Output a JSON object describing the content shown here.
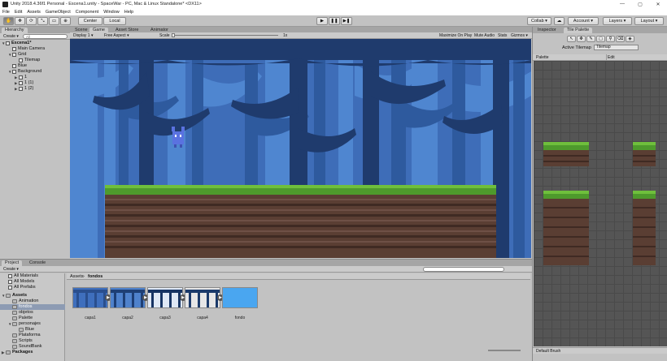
{
  "window": {
    "title": "Unity 2018.4.36f1 Personal - Escena1.unity - SpaceWar - PC, Mac & Linux Standalone* <DX11>",
    "minimize": "—",
    "maximize": "▢",
    "close": "✕"
  },
  "menu": [
    "File",
    "Edit",
    "Assets",
    "GameObject",
    "Component",
    "Window",
    "Help"
  ],
  "toolbar": {
    "pivot": "Center",
    "space": "Local",
    "play": "▶",
    "pause": "❚❚",
    "step": "▶❚",
    "collab": "Collab ▾",
    "account": "Account ▾",
    "layers": "Layers ▾",
    "layout": "Layout ▾"
  },
  "hierarchy": {
    "tab": "Hierarchy",
    "create": "Create ▾",
    "search_placeholder": "All",
    "rows": [
      {
        "label": "Escena1*",
        "indent": 0,
        "tri": "▼",
        "bold": true
      },
      {
        "label": "Main Camera",
        "indent": 1,
        "tri": ""
      },
      {
        "label": "Grid",
        "indent": 1,
        "tri": "▼"
      },
      {
        "label": "Tilemap",
        "indent": 2,
        "tri": ""
      },
      {
        "label": "Blue",
        "indent": 1,
        "tri": ""
      },
      {
        "label": "Background",
        "indent": 1,
        "tri": "▼"
      },
      {
        "label": "1",
        "indent": 2,
        "tri": "▶"
      },
      {
        "label": "1 (1)",
        "indent": 2,
        "tri": "▶"
      },
      {
        "label": "1 (2)",
        "indent": 2,
        "tri": "▶"
      }
    ]
  },
  "scene_tabs": {
    "scene": "Scene",
    "game": "Game",
    "asset_store": "Asset Store",
    "animator": "Animator"
  },
  "game_bar": {
    "display": "Display 1 ▾",
    "aspect": "Free Aspect ▾",
    "scale_label": "Scale",
    "scale_value": "1x",
    "maximize": "Maximize On Play",
    "mute": "Mute Audio",
    "stats": "Stats",
    "gizmos": "Gizmos ▾"
  },
  "inspector": {
    "tab": "Inspector",
    "palette_tab": "Tile Palette",
    "active_tilemap_label": "Active Tilemap",
    "active_tilemap_value": "Tilemap",
    "palette_label": "Palette",
    "edit": "Edit",
    "brush": "Default Brush"
  },
  "project": {
    "tab": "Project",
    "console_tab": "Console",
    "create": "Create ▾",
    "breadcrumb": [
      "Assets",
      "fondos"
    ],
    "favorites": [
      "All Materials",
      "All Models",
      "All Prefabs"
    ],
    "tree": [
      {
        "label": "Assets",
        "indent": 0,
        "tri": "▼",
        "bold": true
      },
      {
        "label": "Animation",
        "indent": 1
      },
      {
        "label": "fondos",
        "indent": 1,
        "selected": true
      },
      {
        "label": "objetos",
        "indent": 1
      },
      {
        "label": "Palette",
        "indent": 1
      },
      {
        "label": "personajes",
        "indent": 1,
        "tri": "▼"
      },
      {
        "label": "Blue",
        "indent": 2
      },
      {
        "label": "Plataforma",
        "indent": 1
      },
      {
        "label": "Scripts",
        "indent": 1
      },
      {
        "label": "SoundBank",
        "indent": 1
      },
      {
        "label": "Packages",
        "indent": 0,
        "tri": "▶",
        "bold": true
      }
    ],
    "assets": [
      {
        "label": "capa1",
        "bg": "#3f6fbd",
        "fg": "#2a4f8e"
      },
      {
        "label": "capa2",
        "bg": "#4f82cc",
        "fg": "#1e3f75"
      },
      {
        "label": "capa3",
        "bg": "#dfe8f5",
        "fg": "#173463"
      },
      {
        "label": "capa4",
        "bg": "#e6e6e6",
        "fg": "#1b3a6a"
      },
      {
        "label": "fondo",
        "bg": "#4aa6f0",
        "fg": "#4aa6f0"
      }
    ]
  },
  "colors": {
    "accent": "#8d9bb3",
    "sky": "#3e6db8",
    "grass": "#4e9a2c",
    "dirt": "#5a3e33"
  }
}
